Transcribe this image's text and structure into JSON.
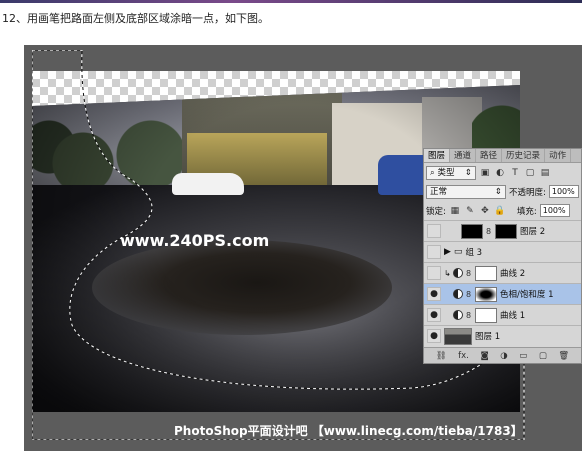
{
  "caption": "12、用画笔把路面左侧及底部区域涂暗一点，如下图。",
  "canvas": {
    "watermark": "www.240PS.com",
    "footer_watermark": "PhotoShop平面设计吧 【www.linecg.com/tieba/1783】"
  },
  "layers_panel": {
    "tabs": [
      "图层",
      "通道",
      "路径",
      "历史记录",
      "动作"
    ],
    "active_tab": "图层",
    "filter_kind": "类型",
    "filter_icons": [
      "image-filter-icon",
      "adjustment-filter-icon",
      "type-filter-icon",
      "shape-filter-icon",
      "smart-object-filter-icon"
    ],
    "blend_mode": "正常",
    "opacity_label": "不透明度:",
    "opacity_value": "100%",
    "lock_label": "锁定:",
    "fill_label": "填充:",
    "fill_value": "100%",
    "layers": [
      {
        "name": "图层 2",
        "visible": false,
        "type": "pixel-with-mask"
      },
      {
        "name": "组 3",
        "visible": false,
        "type": "group"
      },
      {
        "name": "曲线 2",
        "visible": false,
        "type": "adjustment-clipped"
      },
      {
        "name": "色相/饱和度 1",
        "visible": true,
        "type": "adjustment-masked",
        "selected": true
      },
      {
        "name": "曲线 1",
        "visible": true,
        "type": "adjustment"
      },
      {
        "name": "图层 1",
        "visible": true,
        "type": "pixel"
      }
    ],
    "footer_icons": [
      "link-icon",
      "fx-icon",
      "add-mask-icon",
      "adjustment-icon",
      "folder-icon",
      "new-layer-icon",
      "trash-icon"
    ],
    "fx_label": "fx."
  },
  "colors": {
    "canvas_bg": "#5c5c5c",
    "selected_layer": "#a9c3e8",
    "panel_bg": "#d6d6d6"
  }
}
